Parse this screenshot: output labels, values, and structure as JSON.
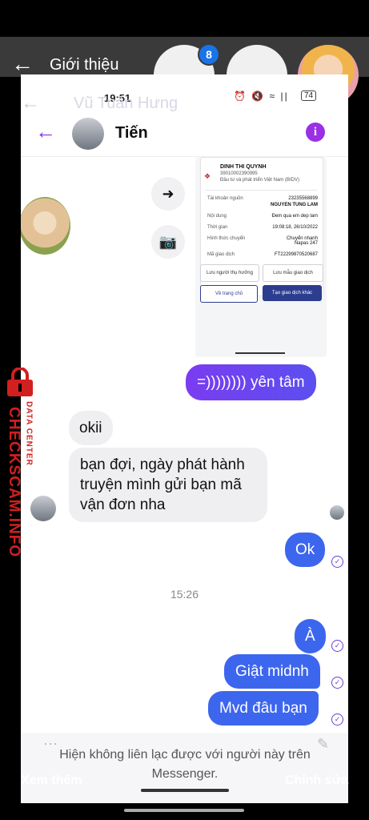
{
  "outer": {
    "title": "Giới thiệu",
    "badge_count": "8",
    "back_icon": "arrow-left-icon"
  },
  "ghost": {
    "time": "19:51",
    "name": "Vũ Tuấn Hưng",
    "battery": "74"
  },
  "header": {
    "contact_name": "Tiến",
    "info_glyph": "i"
  },
  "receipt": {
    "payer_name": "DINH THI QUYNH",
    "payer_account": "39010002390995",
    "payer_bank": "Đầu tư và phát triển Việt Nam (BIDV)",
    "rows": [
      {
        "label": "Tài khoản nguồn",
        "value": "23235568899"
      },
      {
        "label": "",
        "value": "NGUYEN TUNG LAM"
      },
      {
        "label": "Nội dung",
        "value": "Đem qua em dep lam"
      },
      {
        "label": "Thời gian",
        "value": "19:08:18, 26/10/2022"
      },
      {
        "label": "Hình thức chuyển",
        "value": "Chuyển nhanh Napas 247"
      },
      {
        "label": "Mã giao dịch",
        "value": "FT22299870520687"
      }
    ],
    "save_beneficiary": "Lưu người thụ hưởng",
    "save_template": "Lưu mẫu giao dịch",
    "home_button": "Về trang chủ",
    "new_transaction_button": "Tạo giao dịch khác"
  },
  "messages": {
    "m1": "=)))))))) yên tâm",
    "m2": "okii",
    "m3": "bạn đợi, ngày phát hành truyện mình gửi bạn mã vận đơn nha",
    "m4": "Ok",
    "time_divider": "15:26",
    "m5": "À",
    "m6": "Giật midnh",
    "m7": "Mvd đâu bạn"
  },
  "footer": {
    "notice": "Hiện không liên lạc được với người này trên Messenger."
  },
  "overlay": {
    "see_more": "Xem thêm",
    "edit": "Chỉnh sửa"
  },
  "watermark": {
    "small": "DATA CENTER",
    "big": "CHECKSCAM.INFO"
  },
  "colors": {
    "accent_purple": "#8b2fe0",
    "bubble_blue": "#3d66ee",
    "watermark_red": "#d21f1f"
  }
}
